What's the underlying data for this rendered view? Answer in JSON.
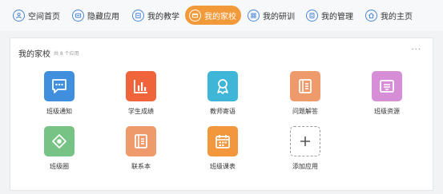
{
  "nav": {
    "items": [
      {
        "label": "空间首页",
        "icon": "user-icon"
      },
      {
        "label": "隐藏应用",
        "icon": "hidden-apps-icon"
      },
      {
        "label": "我的教学",
        "icon": "teaching-icon"
      },
      {
        "label": "我的家校",
        "icon": "home-school-icon",
        "active": true
      },
      {
        "label": "我的研训",
        "icon": "research-icon"
      },
      {
        "label": "我的管理",
        "icon": "management-icon"
      },
      {
        "label": "我的主页",
        "icon": "home-icon"
      }
    ]
  },
  "panel": {
    "title": "我的家校",
    "count": "共 8 个应用",
    "more": "···"
  },
  "apps": [
    {
      "label": "班级通知",
      "icon": "chat-icon",
      "color": "#3f8fde"
    },
    {
      "label": "学生成绩",
      "icon": "bar-chart-icon",
      "color": "#f0643c"
    },
    {
      "label": "教师寄语",
      "icon": "award-icon",
      "color": "#3fb6d8"
    },
    {
      "label": "问题解答",
      "icon": "document-icon",
      "color": "#ef9a6a"
    },
    {
      "label": "班级资源",
      "icon": "resource-icon",
      "color": "#d68ed6"
    },
    {
      "label": "班级圈",
      "icon": "circle-icon",
      "color": "#77c285"
    },
    {
      "label": "联系本",
      "icon": "notebook-icon",
      "color": "#ef9a6a"
    },
    {
      "label": "班级课表",
      "icon": "calendar-icon",
      "color": "#f3973d"
    },
    {
      "label": "添加应用",
      "icon": "plus-icon",
      "color": "#ffffff"
    }
  ],
  "colors": {
    "accent": "#f29a3a",
    "nav_icon": "#4a86d6"
  }
}
